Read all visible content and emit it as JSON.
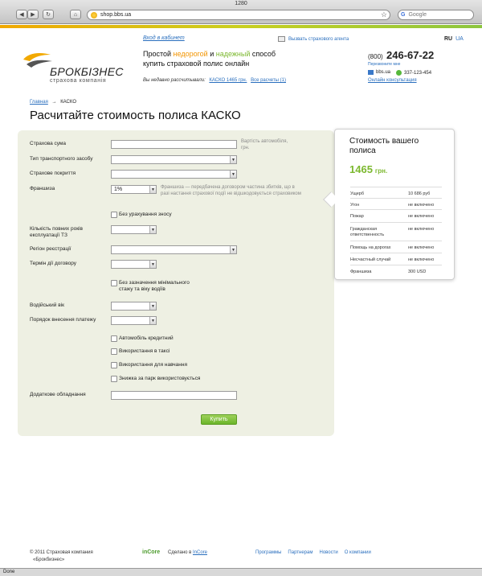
{
  "browser": {
    "window_title": "1280",
    "url": "shop.bbs.ua",
    "search_placeholder": "Google",
    "status": "Done"
  },
  "header": {
    "logo_name": "БРОКБІЗНЕС",
    "logo_sub": "страхова компанія",
    "cabinet_link": "Вход в кабинет",
    "agent_link": "Вызвать страхового агента",
    "tagline": {
      "p1": "Простой ",
      "p2": "недорогой",
      "p3": " и ",
      "p4": "надежный",
      "p5": " способ",
      "line2": "купить страховой полис онлайн"
    },
    "recent_label": "Вы недавно рассчитывали:",
    "recent_link": "КАСКО 1465 грн.",
    "recent_all": "Все расчеты (1)",
    "lang_ru": "RU",
    "lang_ua": "UA",
    "phone_code": "(800)",
    "phone_number": "246-67-22",
    "phone_free": "Перезвоните мне",
    "email": "bbs.ua",
    "skype": "337-123-454",
    "consult_link": "Онлайн консультация"
  },
  "breadcrumb": {
    "home": "Главная",
    "sep": "→",
    "current": "КАСКО"
  },
  "page_title": "Расчитайте стоимость полиса КАСКО",
  "form": {
    "sum_label": "Страхова сума",
    "sum_hint": "Вартість автомобіля, грн.",
    "vehicle_type_label": "Тип транспортного засобу",
    "coverage_label": "Страхове покриття",
    "franchise_label": "Франшиза",
    "franchise_value": "1%",
    "franchise_hint": "Франшиза — передбачена договором частина збитків, що в разі настання страхової події не відшкодовується страховиком",
    "no_wear_label": "Без урахування зносу",
    "years_label": "Кількість повних років експлуатації ТЗ",
    "region_label": "Регіон реєстрації",
    "term_label": "Термін дії договору",
    "no_experience_label": "Без зазначення мінімального стажу та віку водіїв",
    "driver_age_label": "Водійський вік",
    "payment_order_label": "Порядок внесення платежу",
    "credit_label": "Автомобіль кредитний",
    "taxi_label": "Використання в таксі",
    "training_label": "Використання для навчання",
    "fleet_label": "Знижка за парк використовується",
    "equipment_label": "Додаткове обладнання",
    "buy_button": "Купить"
  },
  "price_card": {
    "title": "Стоимость вашего полиса",
    "price": "1465",
    "currency": "грн.",
    "rows": [
      {
        "k": "Ущерб",
        "v": "10 686 руб"
      },
      {
        "k": "Угон",
        "v": "не включено"
      },
      {
        "k": "Пожар",
        "v": "не включено"
      },
      {
        "k": "Гражданская ответственность",
        "v": "не включено"
      },
      {
        "k": "Помощь на дорогах",
        "v": "не включено"
      },
      {
        "k": "Несчастный случай",
        "v": "не включено"
      },
      {
        "k": "Франшиза",
        "v": "300 USD"
      }
    ]
  },
  "footer": {
    "copyright_line1": "© 2011 Страховая компания",
    "copyright_line2": "«Брокбизнес»",
    "incore_logo": "inCore",
    "made_by": "Сделано в ",
    "made_link": "InCore",
    "links": [
      "Программы",
      "Партнерам",
      "Новости",
      "О компании"
    ]
  },
  "colors": {
    "accent_green": "#7cb82f",
    "accent_orange": "#f29400",
    "link_blue": "#2a6fbe",
    "panel_bg": "#eef0e3"
  }
}
